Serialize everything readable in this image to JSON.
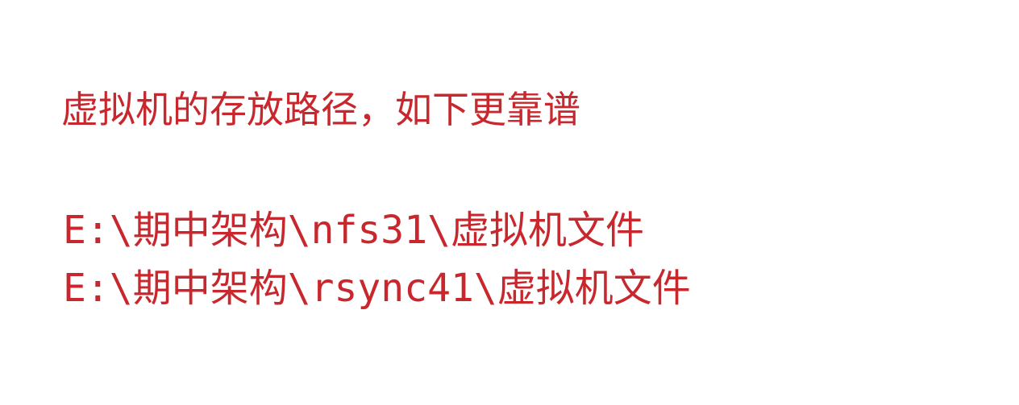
{
  "text_color": "#c8282d",
  "note": {
    "heading": "虚拟机的存放路径，如下更靠谱",
    "paths": [
      "E:\\期中架构\\nfs31\\虚拟机文件",
      "E:\\期中架构\\rsync41\\虚拟机文件"
    ]
  }
}
